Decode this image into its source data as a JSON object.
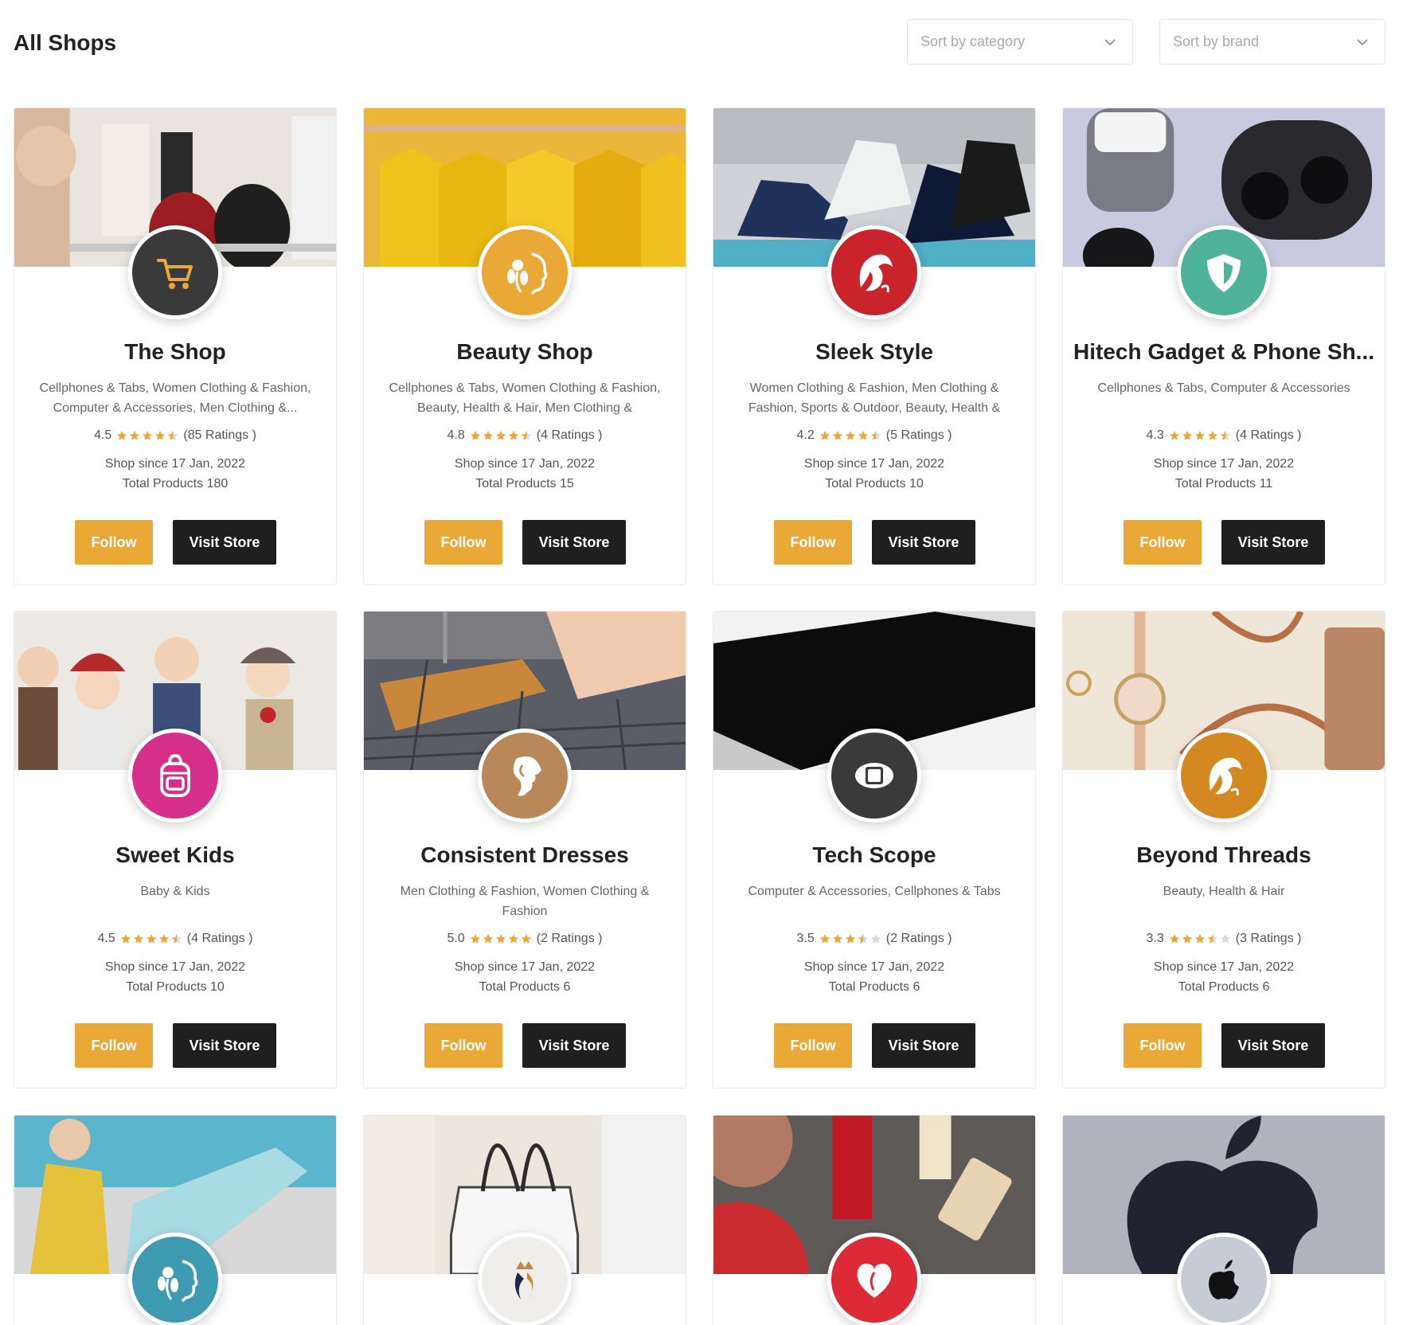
{
  "page": {
    "title": "All Shops"
  },
  "filters": {
    "category_placeholder": "Sort by category",
    "brand_placeholder": "Sort by brand"
  },
  "colors": {
    "accent": "#eaa937",
    "dark_button": "#1f1f1f",
    "star": "#eaa937",
    "star_empty": "#d8d8d8"
  },
  "buttons": {
    "follow_label": "Follow",
    "visit_label": "Visit Store"
  },
  "shops": [
    {
      "name": "The Shop",
      "categories": "Cellphones & Tabs, Women Clothing & Fashion, Computer & Accessories, Men Clothing &...",
      "rating": "4.5",
      "stars": 4.5,
      "ratings_text": "(85 Ratings )",
      "since": "Shop since 17 Jan, 2022",
      "total": "Total Products 180",
      "logo_color": "#3a3a3a",
      "logo_icon": "cart-icon",
      "banner": "clothing-store"
    },
    {
      "name": "Beauty Shop",
      "categories": "Cellphones & Tabs, Women Clothing & Fashion, Beauty, Health & Hair, Men Clothing & Fashion,...",
      "rating": "4.8",
      "stars": 4.5,
      "ratings_text": "(4 Ratings )",
      "since": "Shop since 17 Jan, 2022",
      "total": "Total Products 15",
      "logo_color": "#eaa937",
      "logo_icon": "flower-face-icon",
      "banner": "yellow-clothes"
    },
    {
      "name": "Sleek Style",
      "categories": "Women Clothing & Fashion, Men Clothing & Fashion, Sports & Outdoor, Beauty, Health & Hair",
      "rating": "4.2",
      "stars": 4.5,
      "ratings_text": "(5 Ratings )",
      "since": "Shop since 17 Jan, 2022",
      "total": "Total Products 10",
      "logo_color": "#c9242c",
      "logo_icon": "woman-hair-icon",
      "banner": "shoes"
    },
    {
      "name": "Hitech Gadget & Phone Sh...",
      "categories": "Cellphones & Tabs, Computer & Accessories",
      "rating": "4.3",
      "stars": 4.5,
      "ratings_text": "(4 Ratings )",
      "since": "Shop since 17 Jan, 2022",
      "total": "Total Products 11",
      "logo_color": "#4fb39c",
      "logo_icon": "shield-icon",
      "banner": "earbuds"
    },
    {
      "name": "Sweet Kids",
      "categories": "Baby & Kids",
      "rating": "4.5",
      "stars": 4.5,
      "ratings_text": "(4 Ratings )",
      "since": "Shop since 17 Jan, 2022",
      "total": "Total Products 10",
      "logo_color": "#d62f8a",
      "logo_icon": "backpack-icon",
      "banner": "kids"
    },
    {
      "name": "Consistent Dresses",
      "categories": "Men Clothing & Fashion, Women Clothing & Fashion",
      "rating": "5.0",
      "stars": 5,
      "ratings_text": "(2 Ratings )",
      "since": "Shop since 17 Jan, 2022",
      "total": "Total Products 6",
      "logo_color": "#b88858",
      "logo_icon": "woman-profile-icon",
      "banner": "hanger"
    },
    {
      "name": "Tech Scope",
      "categories": "Computer & Accessories, Cellphones & Tabs",
      "rating": "3.5",
      "stars": 3.5,
      "ratings_text": "(2 Ratings )",
      "since": "Shop since 17 Jan, 2022",
      "total": "Total Products 6",
      "logo_color": "#3a3a3a",
      "logo_icon": "band-icon",
      "banner": "laptop"
    },
    {
      "name": "Beyond Threads",
      "categories": "Beauty, Health & Hair",
      "rating": "3.3",
      "stars": 3.5,
      "ratings_text": "(3 Ratings )",
      "since": "Shop since 17 Jan, 2022",
      "total": "Total Products 6",
      "logo_color": "#d38821",
      "logo_icon": "woman-hair-icon",
      "banner": "watch-bag"
    },
    {
      "name": "",
      "categories": "",
      "rating": "",
      "stars": 0,
      "ratings_text": "",
      "since": "",
      "total": "",
      "logo_color": "#3d9ab0",
      "logo_icon": "flower-face-icon",
      "banner": "woman-blue"
    },
    {
      "name": "",
      "categories": "",
      "rating": "",
      "stars": 0,
      "ratings_text": "",
      "since": "",
      "total": "",
      "logo_color": "#efeeea",
      "logo_icon": "crown-face-icon",
      "banner": "handbag"
    },
    {
      "name": "",
      "categories": "",
      "rating": "",
      "stars": 0,
      "ratings_text": "",
      "since": "",
      "total": "",
      "logo_color": "#de2a36",
      "logo_icon": "heart-face-icon",
      "banner": "cosmetics"
    },
    {
      "name": "",
      "categories": "",
      "rating": "",
      "stars": 0,
      "ratings_text": "",
      "since": "",
      "total": "",
      "logo_color": "#c5ccd6",
      "logo_icon": "apple-icon",
      "banner": "apple"
    }
  ]
}
